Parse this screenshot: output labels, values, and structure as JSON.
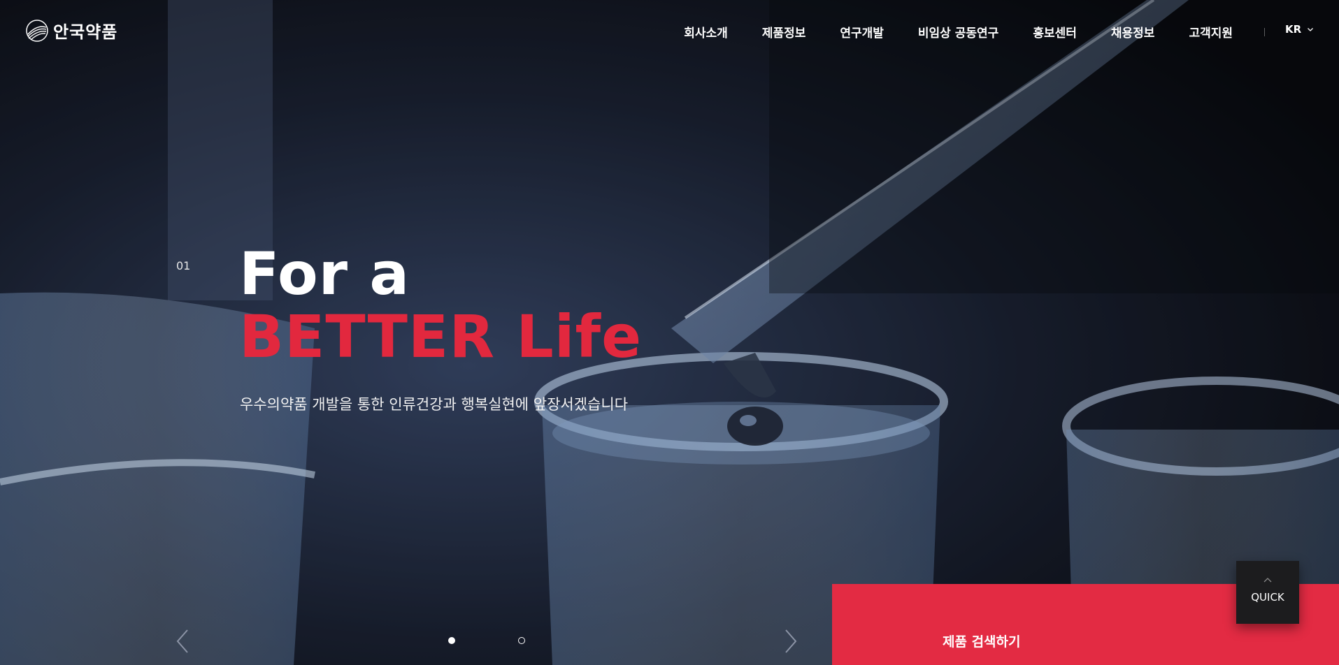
{
  "brand": {
    "name": "안국약품",
    "logo_icon": "sunburst-logo-icon"
  },
  "nav": {
    "items": [
      {
        "label": "회사소개"
      },
      {
        "label": "제품정보"
      },
      {
        "label": "연구개발"
      },
      {
        "label": "비임상 공동연구"
      },
      {
        "label": "홍보센터"
      },
      {
        "label": "채용정보"
      },
      {
        "label": "고객지원"
      }
    ],
    "language": {
      "selected": "KR",
      "icon": "chevron-down-icon"
    }
  },
  "hero": {
    "slide_number": "01",
    "headline_line1": "For a",
    "headline_line2": "BETTER Life",
    "subheadline": "우수의약품 개발을 통한 인류건강과 행복실현에 앞장서겠습니다",
    "accent_color": "#e2283e",
    "slider": {
      "total_slides": 2,
      "active_slide": 1,
      "prev_icon": "chevron-left-icon",
      "next_icon": "chevron-right-icon"
    }
  },
  "product_search": {
    "label": "제품 검색하기",
    "background_color": "#e32b43"
  },
  "quick": {
    "label": "QUICK",
    "icon": "chevron-up-icon"
  }
}
